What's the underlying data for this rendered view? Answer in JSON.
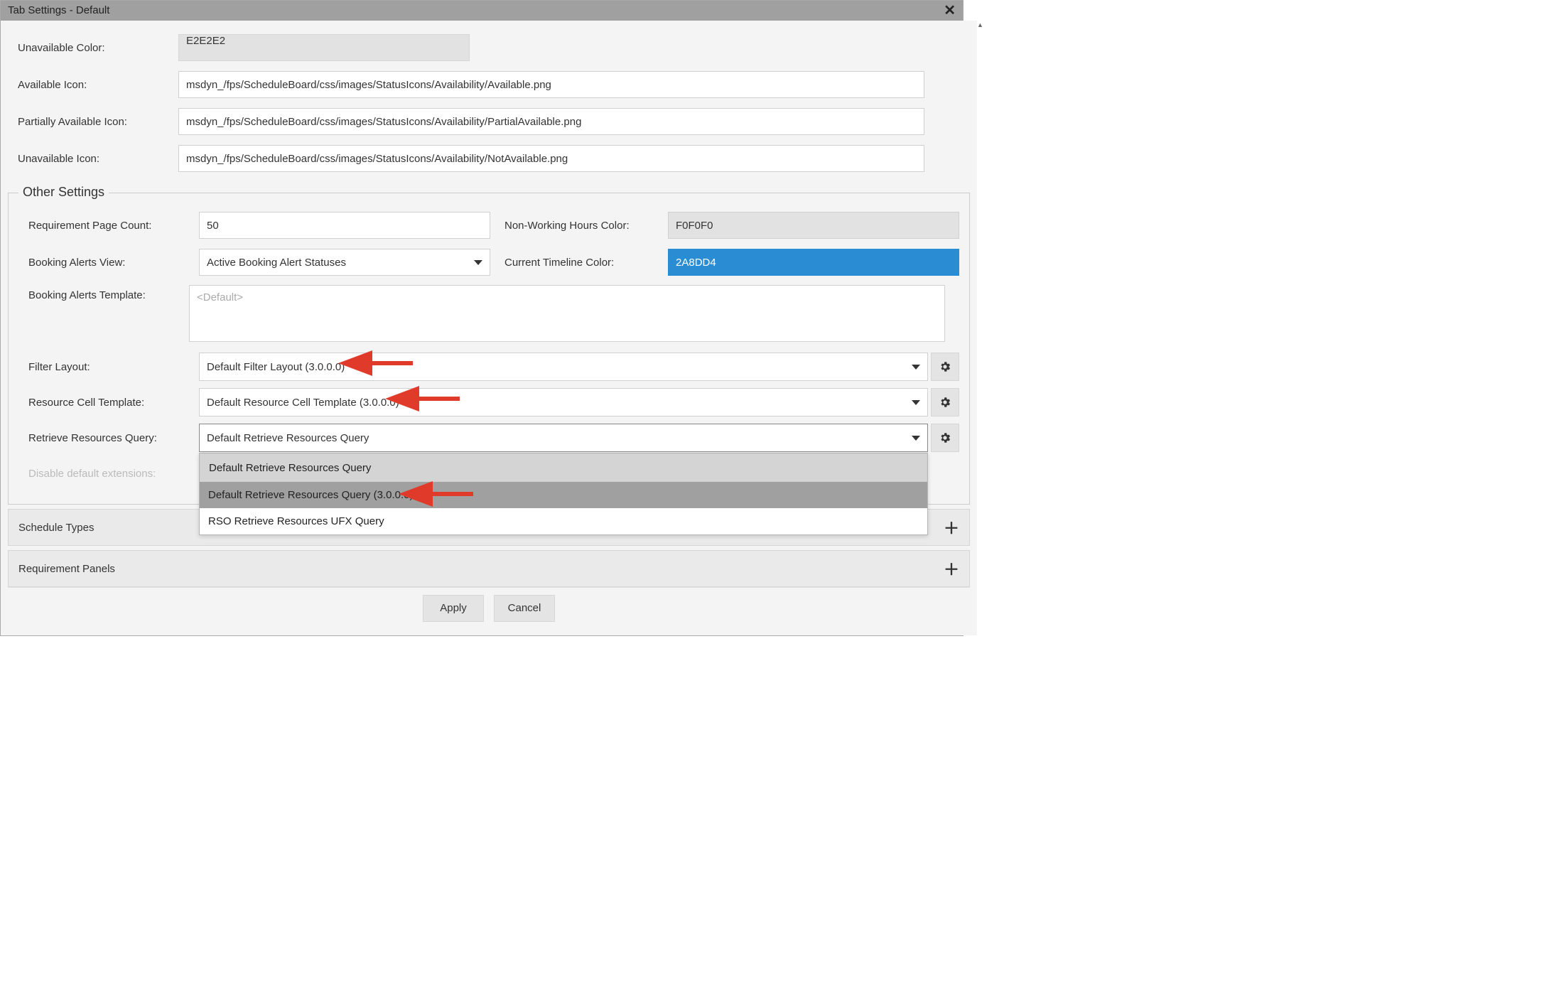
{
  "window": {
    "title": "Tab Settings - Default"
  },
  "top": {
    "unavailable_color_label": "Unavailable Color:",
    "unavailable_color_value": "E2E2E2",
    "available_icon_label": "Available Icon:",
    "available_icon_value": "msdyn_/fps/ScheduleBoard/css/images/StatusIcons/Availability/Available.png",
    "partial_icon_label": "Partially Available Icon:",
    "partial_icon_value": "msdyn_/fps/ScheduleBoard/css/images/StatusIcons/Availability/PartialAvailable.png",
    "unavailable_icon_label": "Unavailable Icon:",
    "unavailable_icon_value": "msdyn_/fps/ScheduleBoard/css/images/StatusIcons/Availability/NotAvailable.png"
  },
  "other": {
    "legend": "Other Settings",
    "req_page_count_label": "Requirement Page Count:",
    "req_page_count_value": "50",
    "nonworking_color_label": "Non-Working Hours Color:",
    "nonworking_color_value": "F0F0F0",
    "booking_alerts_view_label": "Booking Alerts View:",
    "booking_alerts_view_value": "Active Booking Alert Statuses",
    "timeline_color_label": "Current Timeline Color:",
    "timeline_color_value": "2A8DD4",
    "booking_alerts_template_label": "Booking Alerts Template:",
    "booking_alerts_template_placeholder": "<Default>",
    "filter_layout_label": "Filter Layout:",
    "filter_layout_value": "Default Filter Layout (3.0.0.0)",
    "resource_cell_label": "Resource Cell Template:",
    "resource_cell_value": "Default Resource Cell Template (3.0.0.0)",
    "retrieve_query_label": "Retrieve Resources Query:",
    "retrieve_query_value": "Default Retrieve Resources Query",
    "retrieve_query_options": [
      "Default Retrieve Resources Query",
      "Default Retrieve Resources Query (3.0.0.0)",
      "RSO Retrieve Resources UFX Query"
    ],
    "disable_ext_label": "Disable default extensions:"
  },
  "accordions": {
    "schedule_types": "Schedule Types",
    "requirement_panels": "Requirement Panels"
  },
  "footer": {
    "apply": "Apply",
    "cancel": "Cancel"
  }
}
